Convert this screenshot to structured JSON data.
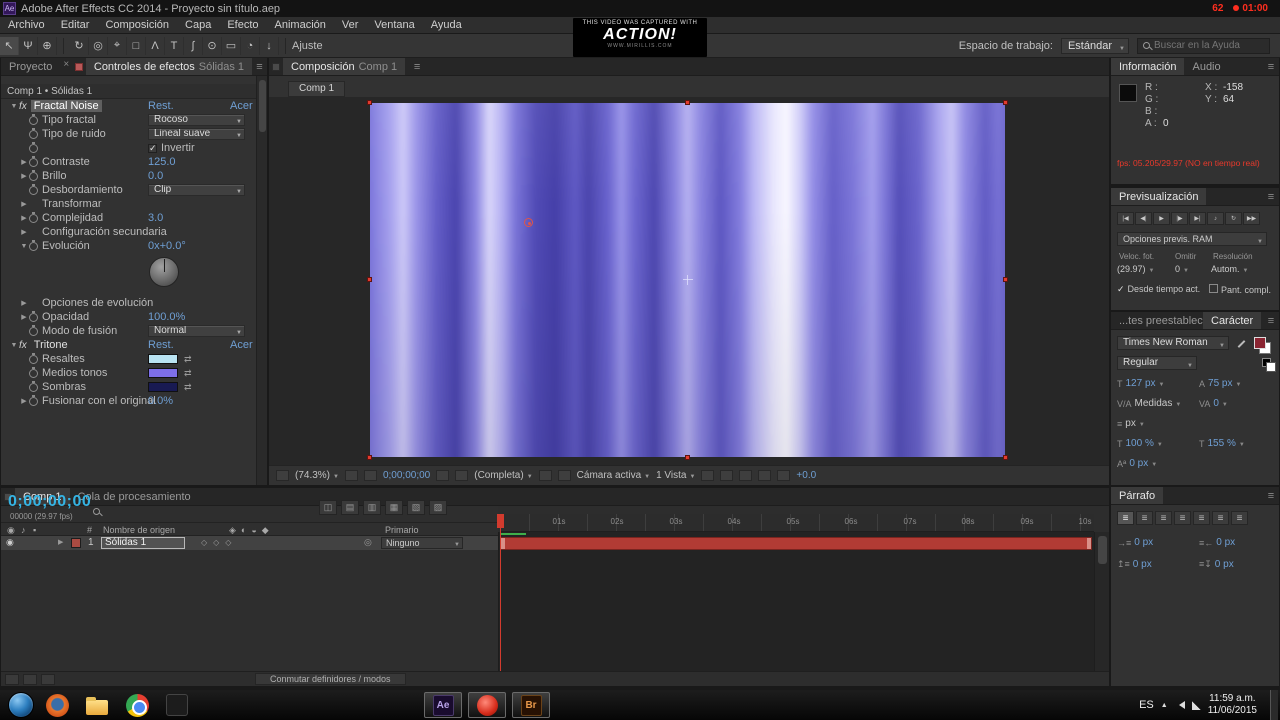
{
  "colors": {
    "value_blue": "#6f9fd4",
    "time_cyan": "#35b4e4",
    "fps_red": "#e8392b",
    "layer_bar_red": "#b23b34",
    "char_fill_color": "#8a2431"
  },
  "title_bar": {
    "title": "Adobe After Effects CC 2014 - Proyecto sin título.aep",
    "hud_fps": "62",
    "hud_time": "01:00"
  },
  "menu_bar": [
    "Archivo",
    "Editar",
    "Composición",
    "Capa",
    "Efecto",
    "Animación",
    "Ver",
    "Ventana",
    "Ayuda"
  ],
  "toolbar": {
    "snap": "Ajuste",
    "workspace_label": "Espacio de trabajo:",
    "workspace_value": "Estándar",
    "search_placeholder": "Buscar en la Ayuda"
  },
  "watermark": {
    "line1": "THIS VIDEO WAS CAPTURED WITH",
    "line2": "ACTION!",
    "line3": "WWW.MIRILLIS.COM"
  },
  "effects_panel": {
    "fx_badge": "fx",
    "tab_project": "Proyecto",
    "tab_title": "Controles de efectos",
    "tab_target": "Sólidas 1",
    "breadcrumb": "Comp 1 • Sólidas 1",
    "rows": [
      {
        "label": "Fractal Noise",
        "reset": "Rest.",
        "about": "Acer"
      },
      {
        "label": "Tipo fractal",
        "value": "Rocoso"
      },
      {
        "label": "Tipo de ruido",
        "value": "Lineal suave"
      },
      {
        "label": "",
        "value": "Invertir"
      },
      {
        "label": "Contraste",
        "value": "125.0"
      },
      {
        "label": "Brillo",
        "value": "0.0"
      },
      {
        "label": "Desbordamiento",
        "value": "Clip"
      },
      {
        "label": "Transformar"
      },
      {
        "label": "Complejidad",
        "value": "3.0"
      },
      {
        "label": "Configuración secundaria"
      },
      {
        "label": "Evolución",
        "value": "0x+0.0°"
      },
      {
        "label": "Opciones de evolución"
      },
      {
        "label": "Opacidad",
        "value": "100.0%"
      },
      {
        "label": "Modo de fusión",
        "value": "Normal"
      },
      {
        "label": "Tritone",
        "reset": "Rest.",
        "about": "Acer"
      },
      {
        "label": "Resaltes",
        "color": "#b9e3f2"
      },
      {
        "label": "Medios tonos",
        "color": "#7d6fe8"
      },
      {
        "label": "Sombras",
        "color": "#181a52"
      },
      {
        "label": "Fusionar con el original",
        "value": "0.0%"
      }
    ]
  },
  "comp_panel": {
    "tab_title": "Composición",
    "tab_target": "Comp 1",
    "viewer_tab": "Comp 1",
    "status": {
      "zoom": "(74.3%)",
      "time": "0;00;00;00",
      "resolution": "(Completa)",
      "camera": "Cámara activa",
      "view": "1 Vista",
      "exposure": "+0.0"
    }
  },
  "info_panel": {
    "tab_info": "Información",
    "tab_audio": "Audio",
    "r": "R :",
    "g": "G :",
    "b": "B :",
    "a": "A :",
    "a_value": "0",
    "x_label": "X :",
    "x_value": "-158",
    "y_label": "Y :",
    "y_value": "64",
    "fps_text": "fps: 05.205/29.97 (NO en tiempo real)"
  },
  "preview_panel": {
    "title": "Previsualización",
    "ram_options": "Opciones previs. RAM",
    "labels": [
      "Veloc. fot.",
      "Omitir",
      "Resolución"
    ],
    "values": [
      "(29.97)",
      "0",
      "Autom."
    ],
    "check_from_current": "Desde tiempo act.",
    "check_fullscreen": "Pant. compl."
  },
  "character_panel": {
    "tab_presets": "...tes preestablecidos",
    "tab_title": "Carácter",
    "font_family": "Times New Roman",
    "font_style": "Regular",
    "font_size": "127 px",
    "leading": "75 px",
    "kerning": "Medidas",
    "tracking": "0",
    "tsume": "px",
    "vertical_scale": "100 %",
    "horizontal_scale": "155 %",
    "baseline_shift": "0 px"
  },
  "paragraph_panel": {
    "title": "Párrafo",
    "indent_left": "0 px",
    "indent_right": "0 px",
    "space_before": "0 px",
    "space_after": "0 px"
  },
  "timeline": {
    "tab_comp": "Comp 1",
    "tab_queue": "Cola de procesamiento",
    "time": "0;00;00;00",
    "frames": "00000 (29.97 fps)",
    "ticks": [
      "01s",
      "02s",
      "03s",
      "04s",
      "05s",
      "06s",
      "07s",
      "08s",
      "09s",
      "10s"
    ],
    "col_number": "#",
    "col_source": "Nombre de origen",
    "col_parent": "Primario",
    "layer_number": "1",
    "layer_name": "Sólidas 1",
    "parent_value": "Ninguno",
    "bottom_toggle": "Conmutar definidores / modos"
  },
  "taskbar": {
    "ae_label": "Ae",
    "br_label": "Br",
    "lang": "ES",
    "time": "11:59 a.m.",
    "date": "11/06/2015"
  }
}
